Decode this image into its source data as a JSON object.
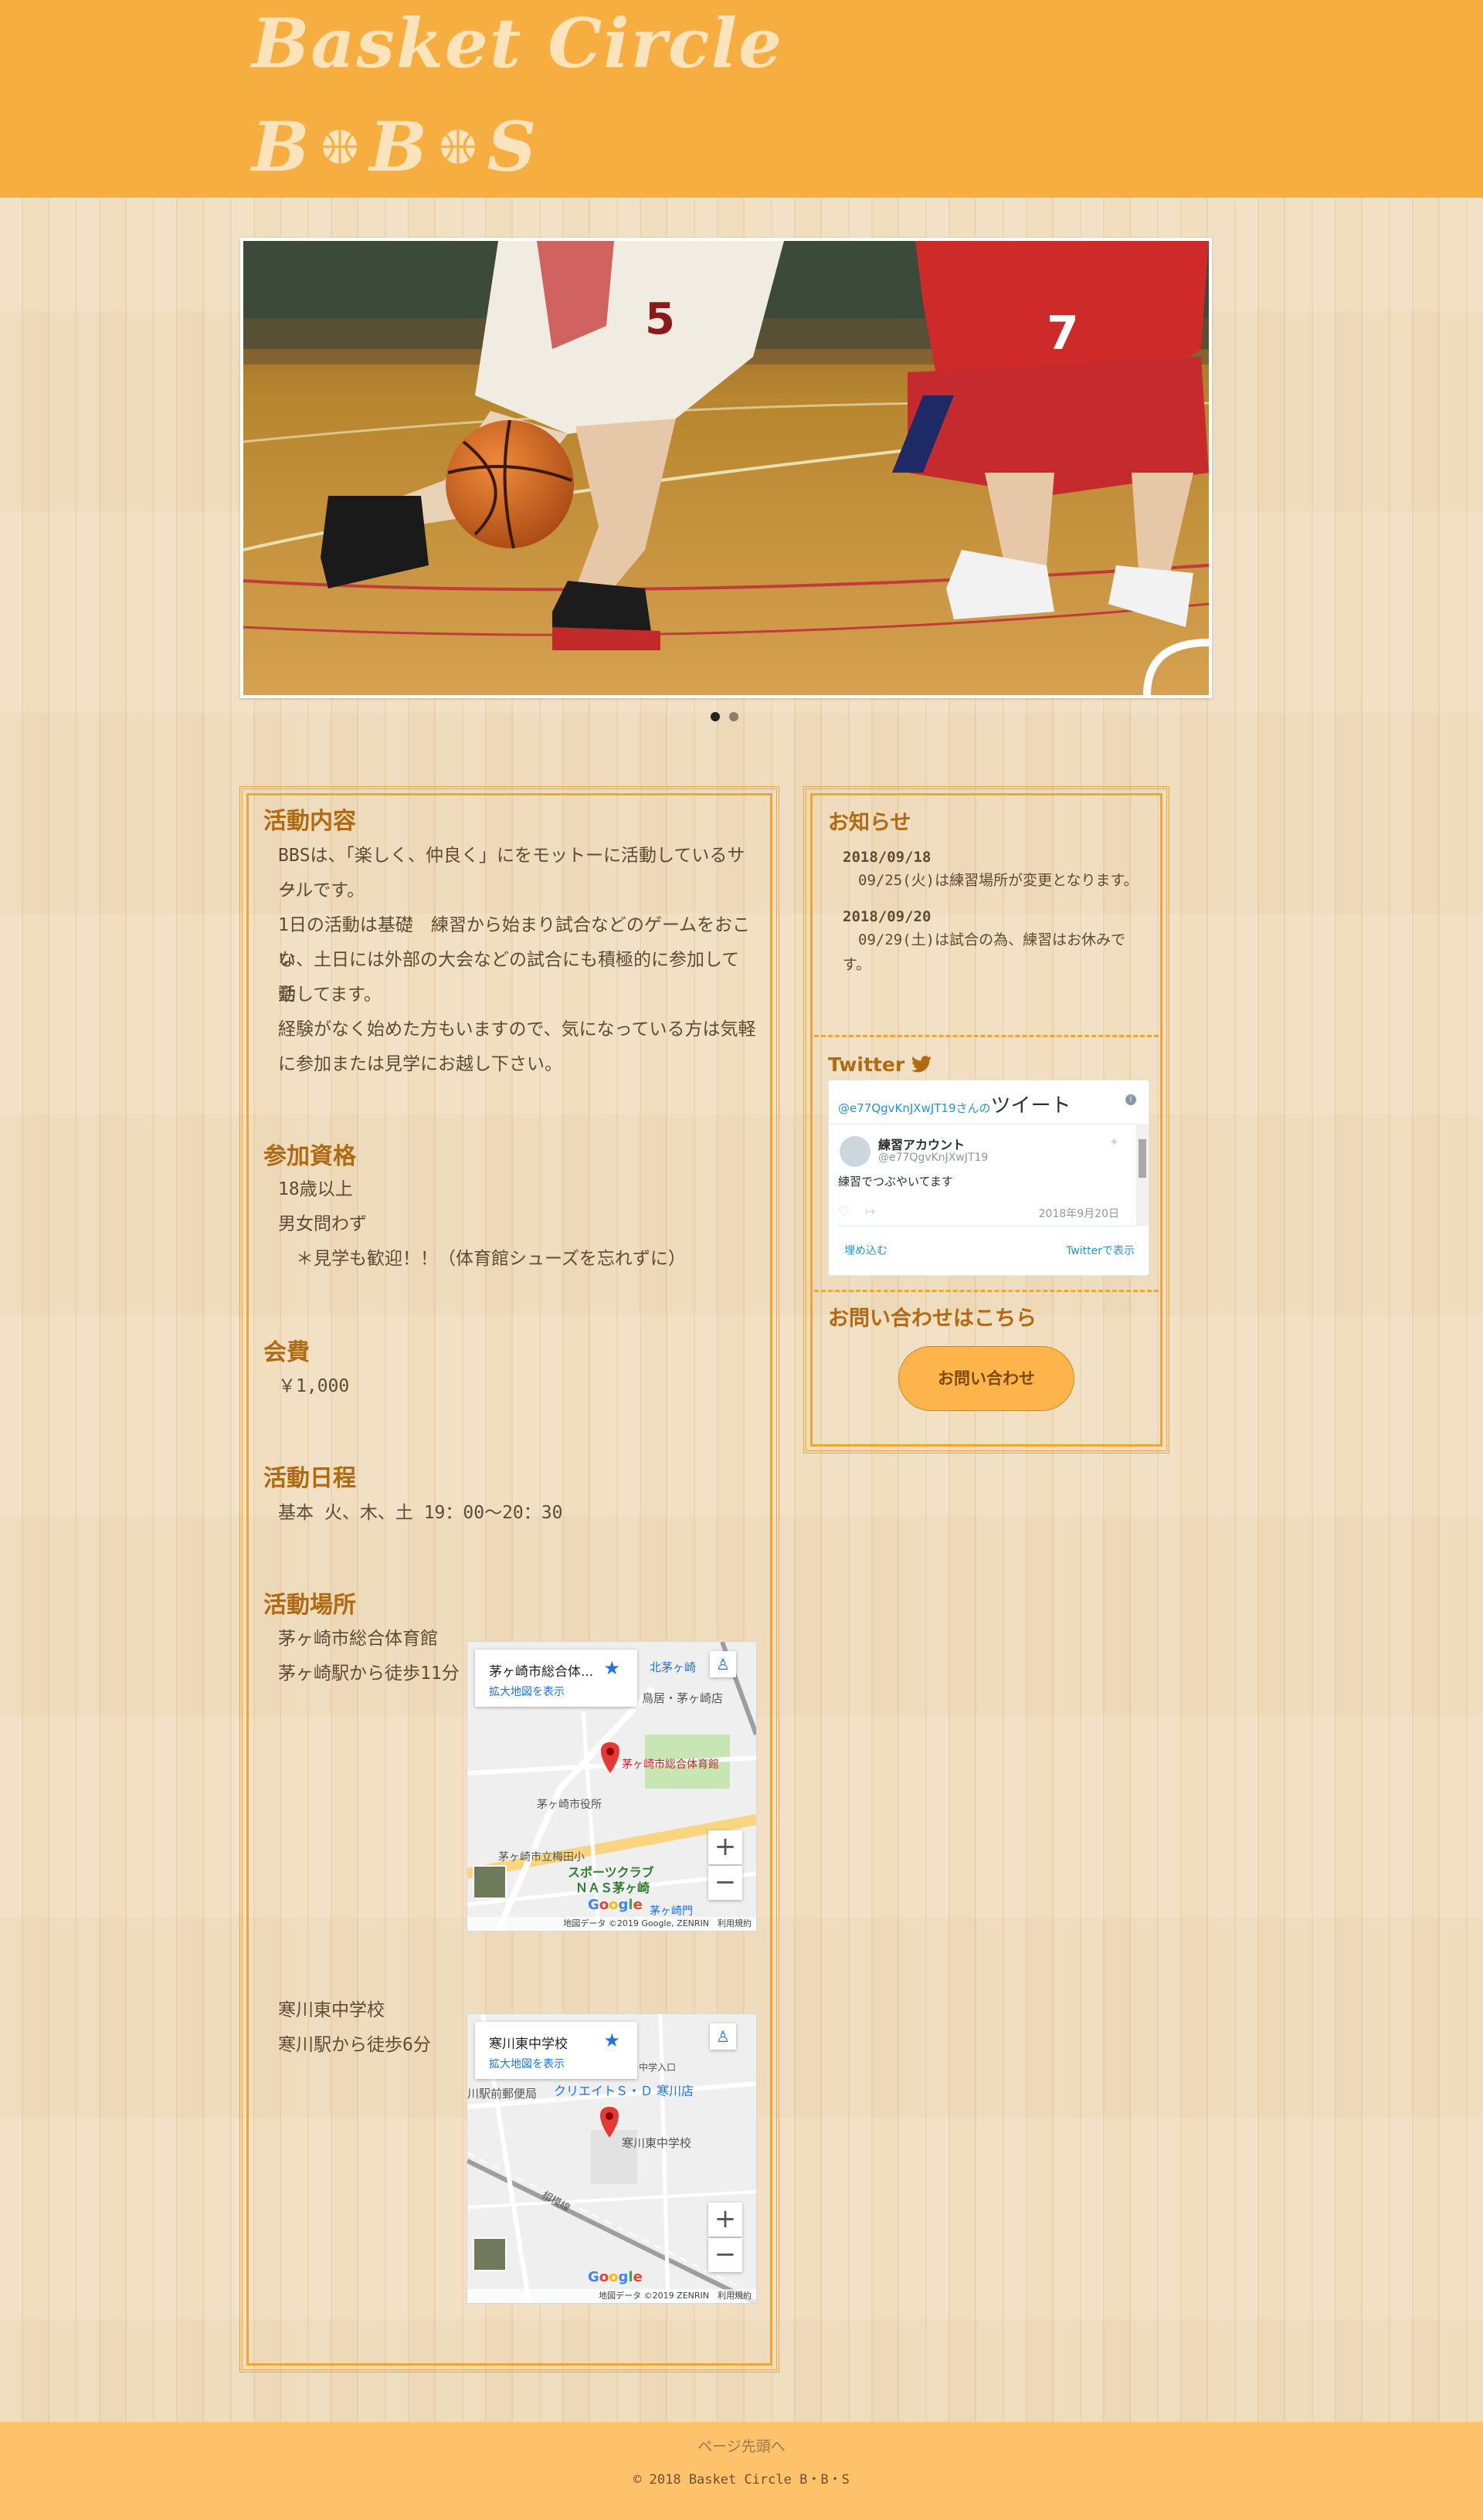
{
  "header": {
    "logo_line1": "Basket Circle",
    "logo_b1": "B",
    "logo_b2": "B",
    "logo_s": "S"
  },
  "slider": {
    "active_slide": 1,
    "total_slides": 2
  },
  "main": {
    "sections": [
      {
        "title": "活動内容",
        "lines": [
          "BBSは、「楽しく、仲良く」にをモットーに活動しているサー",
          "クルです。",
          "1日の活動は基礎　練習から始まり試合などのゲームをおこな",
          "い、土日には外部の大会などの試合にも積極的に参加して活",
          "動してます。",
          "経験がなく始めた方もいますので、気になっている方は気軽",
          "に参加または見学にお越し下さい。"
        ]
      },
      {
        "title": "参加資格",
        "lines": [
          "18歳以上",
          "男女問わず",
          "　＊見学も歓迎！！（体育館シューズを忘れずに）"
        ]
      },
      {
        "title": "会費",
        "lines": [
          "￥1,000"
        ]
      },
      {
        "title": "活動日程",
        "lines": [
          "基本 火、木、土 19：00〜20：30"
        ]
      },
      {
        "title": "活動場所",
        "places": [
          {
            "name": "茅ヶ崎市総合体育館",
            "access": "茅ヶ崎駅から徒歩11分",
            "map_name": "茅ヶ崎市総合体...",
            "map_link": "拡大地図を表示",
            "map_footer": "地図データ ©2019 Google, ZENRIN　利用規約",
            "map_labels": [
              "北茅ヶ崎",
              "鳥居・茅ヶ崎店",
              "茅ヶ崎市総合体育館",
              "茅ヶ崎市役所",
              "茅ヶ崎市立梅田小",
              "スポーツクラブ",
              "ＮＡＳ茅ヶ崎",
              "茅ヶ崎門"
            ]
          },
          {
            "name": "寒川東中学校",
            "access": "寒川駅から徒歩6分",
            "map_name": "寒川東中学校",
            "map_link": "拡大地図を表示",
            "map_footer": "地図データ ©2019 ZENRIN　利用規約",
            "map_labels": [
              "クリエイトＳ・Ｄ 寒川店",
              "川駅前郵便局",
              "寒川東中学校",
              "相模線",
              "中学入口"
            ]
          }
        ]
      }
    ]
  },
  "side": {
    "news_title": "お知らせ",
    "news": [
      {
        "date": "2018/09/18",
        "text": "09/25(火)は練習場所が変更となります。"
      },
      {
        "date": "2018/09/20",
        "text": "09/29(土)は試合の為、練習はお休みです。"
      }
    ],
    "twitter_title": "Twitter",
    "twitter": {
      "handle_head": "@e77QgvKnJXwJT19さんの",
      "tweets_label": "ツイート",
      "account_name": "練習アカウント",
      "account_handle": "@e77QgvKnJXwJT19",
      "body": "練習でつぶやいてます",
      "date": "2018年9月20日",
      "embed": "埋め込む",
      "view": "Twitterで表示"
    },
    "contact_title": "お問い合わせはこちら",
    "contact_button": "お問い合わせ"
  },
  "footer": {
    "to_top": "ページ先頭へ",
    "copyright": "© 2018 Basket Circle B・B・S"
  },
  "colors": {
    "header_bg": "#f6ae40",
    "accent": "#f3a533",
    "title": "#b06a12",
    "footer_bg": "#fdc26a",
    "button": "#fdb44b"
  }
}
